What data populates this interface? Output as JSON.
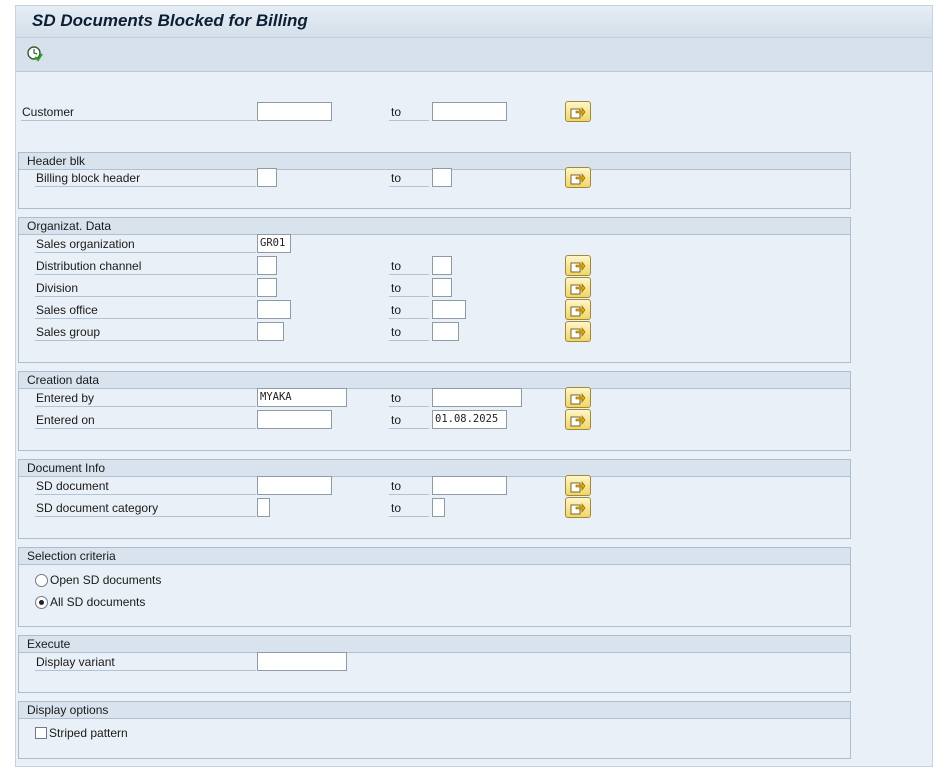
{
  "title": "SD Documents Blocked for Billing",
  "toolbar": {
    "execute_icon": "execute-clock-icon"
  },
  "to_label": "to",
  "customer": {
    "label": "Customer",
    "from": "",
    "to": ""
  },
  "header_blk": {
    "title": "Header blk",
    "billing_block_header": {
      "label": "Billing block header",
      "from": "",
      "to": ""
    }
  },
  "organizat": {
    "title": "Organizat. Data",
    "sales_org": {
      "label": "Sales organization",
      "value": "GR01"
    },
    "distribution_channel": {
      "label": "Distribution channel",
      "from": "",
      "to": ""
    },
    "division": {
      "label": "Division",
      "from": "",
      "to": ""
    },
    "sales_office": {
      "label": "Sales office",
      "from": "",
      "to": ""
    },
    "sales_group": {
      "label": "Sales group",
      "from": "",
      "to": ""
    }
  },
  "creation": {
    "title": "Creation data",
    "entered_by": {
      "label": "Entered by",
      "from": "MYAKA",
      "to": ""
    },
    "entered_on": {
      "label": "Entered on",
      "from": "",
      "to": "01.08.2025"
    }
  },
  "docinfo": {
    "title": "Document Info",
    "sd_document": {
      "label": "SD document",
      "from": "",
      "to": ""
    },
    "sd_document_category": {
      "label": "SD document category",
      "from": "",
      "to": ""
    }
  },
  "selection": {
    "title": "Selection criteria",
    "open_label": "Open SD documents",
    "all_label": "All SD documents",
    "selected": "all"
  },
  "execute": {
    "title": "Execute",
    "display_variant": {
      "label": "Display variant",
      "value": ""
    }
  },
  "display_options": {
    "title": "Display options",
    "striped_label": "Striped pattern",
    "striped_checked": false
  },
  "colors": {
    "multi_button": "#f0d66a",
    "background": "#eaf0f7",
    "header": "#d8e3ee"
  }
}
